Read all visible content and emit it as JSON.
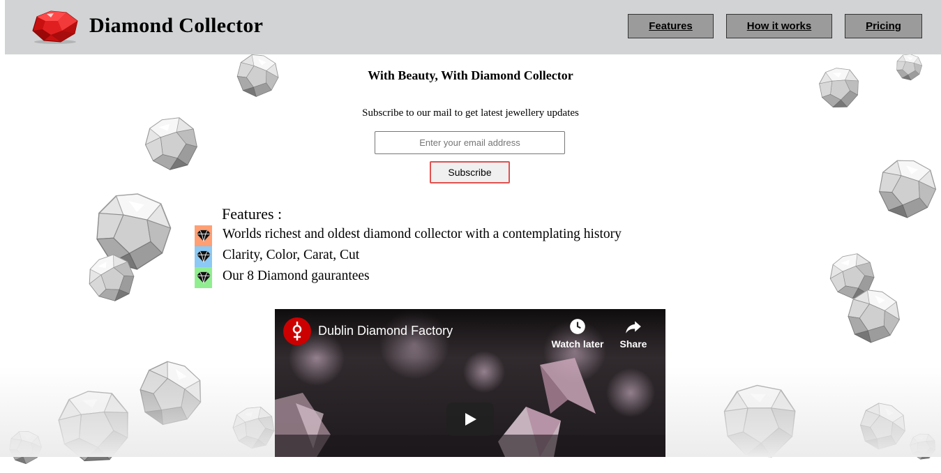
{
  "header": {
    "brand": "Diamond Collector",
    "nav": [
      {
        "label": "Features"
      },
      {
        "label": "How it works"
      },
      {
        "label": "Pricing"
      }
    ]
  },
  "hero": {
    "tagline": "With Beauty, With Diamond Collector",
    "subscribe_text": "Subscribe to our mail to get latest jewellery updates",
    "email_placeholder": "Enter your email address",
    "subscribe_label": "Subscribe"
  },
  "features": {
    "title": "Features :",
    "items": [
      {
        "text": "Worlds richest and oldest diamond collector with a contemplating history",
        "color": "#ff9f73"
      },
      {
        "text": "Clarity, Color, Carat, Cut",
        "color": "#8cc9f4"
      },
      {
        "text": "Our 8 Diamond gaurantees",
        "color": "#90ee90"
      }
    ],
    "icon": "diamond-icon"
  },
  "video": {
    "title": "Dublin Diamond Factory",
    "watch_later": "Watch later",
    "share": "Share",
    "brand_color": "#cc0000"
  }
}
